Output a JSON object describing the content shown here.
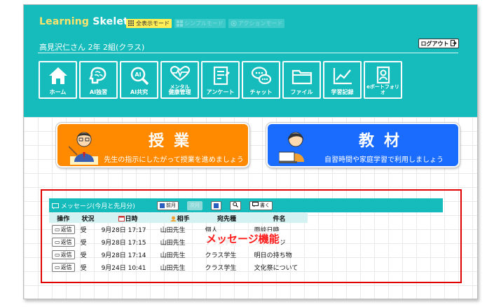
{
  "app": {
    "logo_word1": "Learning",
    "logo_word2": "Skeleton",
    "modes": [
      {
        "label": "全表示モード",
        "active": true
      },
      {
        "label": "シンプルモード",
        "active": false
      },
      {
        "label": "アクションモード",
        "active": false
      }
    ],
    "user_name": "高見沢仁さん 2年 2組(クラス)",
    "logout_label": "ログアウト"
  },
  "nav": [
    {
      "label": "ホーム",
      "icon": "home-icon"
    },
    {
      "label": "AI独習",
      "icon": "brain-icon"
    },
    {
      "label": "AI共究",
      "icon": "ai-search-icon"
    },
    {
      "label_top": "メンタル",
      "label": "健康管理",
      "icon": "heartbeat-icon"
    },
    {
      "label": "アンケート",
      "icon": "survey-icon"
    },
    {
      "label": "チャット",
      "icon": "chat-icon"
    },
    {
      "label": "ファイル",
      "icon": "folder-icon"
    },
    {
      "label": "学習記録",
      "icon": "chart-icon"
    },
    {
      "label": "eポートフォリオ",
      "icon": "portfolio-icon"
    }
  ],
  "big_buttons": {
    "jugyo": {
      "title": "授業",
      "sub": "先生の指示にしたがって授業を進めましょう",
      "color": "#ff8a00"
    },
    "kyozai": {
      "title": "教材",
      "sub": "自習時間や家庭学習で利用しましょう",
      "color": "#1a6cff"
    }
  },
  "messages": {
    "title": "メッセージ(今月と先月分)",
    "prev_label": "前月",
    "next_label": "次月",
    "write_label": "書く",
    "columns": [
      "操作",
      "状況",
      "日時",
      "相手",
      "宛先種",
      "件名"
    ],
    "reply_label": "返信",
    "rows": [
      {
        "status": "受",
        "datetime": "9月28日 17:17",
        "partner": "山田先生",
        "dest": "個人",
        "subject": "面談日時"
      },
      {
        "status": "受",
        "datetime": "9月28日 17:15",
        "partner": "山田先生",
        "dest": "クラス学生",
        "subject": "メッセージ"
      },
      {
        "status": "受",
        "datetime": "9月28日 17:14",
        "partner": "山田先生",
        "dest": "クラス学生",
        "subject": "明日の持ち物"
      },
      {
        "status": "受",
        "datetime": "9月24日 10:41",
        "partner": "山田先生",
        "dest": "クラス学生",
        "subject": "文化祭について"
      }
    ]
  },
  "annotation": "メッセージ機能",
  "colors": {
    "header": "#16bcbc",
    "highlight": "#e00000"
  }
}
